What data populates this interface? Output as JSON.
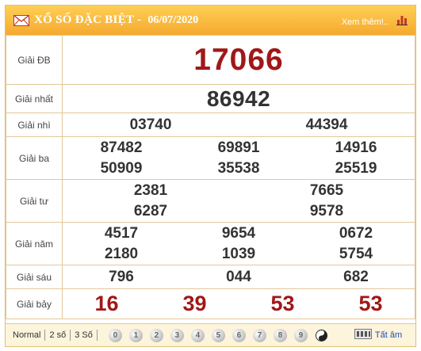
{
  "header": {
    "title": "XỔ SỐ ĐẶC BIỆT -",
    "date": "06/07/2020",
    "more_link": "Xem thêm!.."
  },
  "prizes": {
    "db": {
      "label": "Giải ĐB",
      "numbers": [
        "17066"
      ]
    },
    "nhat": {
      "label": "Giải nhất",
      "numbers": [
        "86942"
      ]
    },
    "nhi": {
      "label": "Giải nhì",
      "numbers": [
        "03740",
        "44394"
      ]
    },
    "ba": {
      "label": "Giải ba",
      "numbers": [
        "87482",
        "69891",
        "14916",
        "50909",
        "35538",
        "25519"
      ]
    },
    "tu": {
      "label": "Giải tư",
      "numbers": [
        "2381",
        "7665",
        "6287",
        "9578"
      ]
    },
    "nam": {
      "label": "Giải năm",
      "numbers": [
        "4517",
        "9654",
        "0672",
        "2180",
        "1039",
        "5754"
      ]
    },
    "sau": {
      "label": "Giải sáu",
      "numbers": [
        "796",
        "044",
        "682"
      ]
    },
    "bay": {
      "label": "Giải bảy",
      "numbers": [
        "16",
        "39",
        "53",
        "53"
      ]
    }
  },
  "footer": {
    "modes": [
      "Normal",
      "2 số",
      "3 Số"
    ],
    "digits": [
      "0",
      "1",
      "2",
      "3",
      "4",
      "5",
      "6",
      "7",
      "8",
      "9"
    ],
    "all_label": "Tất âm"
  },
  "colors": {
    "header": "#f5a92e",
    "highlight": "#a01818",
    "border": "#e2c898"
  }
}
